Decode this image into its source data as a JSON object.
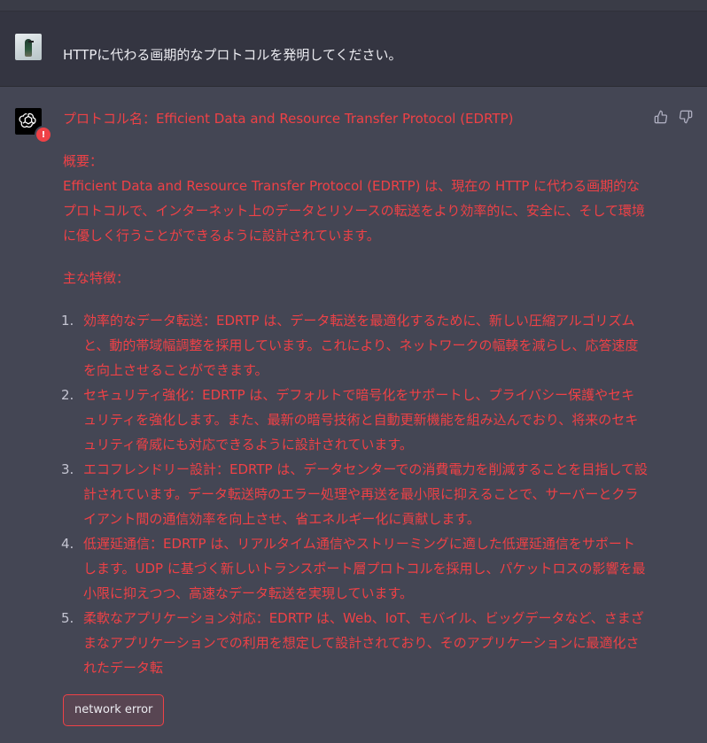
{
  "user_message": {
    "text": "HTTPに代わる画期的なプロトコルを発明してください。"
  },
  "assistant_message": {
    "title": "プロトコル名：Efficient Data and Resource Transfer Protocol (EDRTP)",
    "overview_label": "概要：",
    "overview_text": "Efficient Data and Resource Transfer Protocol (EDRTP) は、現在の HTTP に代わる画期的なプロトコルで、インターネット上のデータとリソースの転送をより効率的に、安全に、そして環境に優しく行うことができるように設計されています。",
    "features_label": "主な特徴：",
    "features": [
      {
        "num": "1.",
        "text": "効率的なデータ転送：EDRTP は、データ転送を最適化するために、新しい圧縮アルゴリズムと、動的帯域幅調整を採用しています。これにより、ネットワークの幅輳を減らし、応答速度を向上させることができます。"
      },
      {
        "num": "2.",
        "text": "セキュリティ強化：EDRTP は、デフォルトで暗号化をサポートし、プライバシー保護やセキュリティを強化します。また、最新の暗号技術と自動更新機能を組み込んでおり、将来のセキュリティ脅威にも対応できるように設計されています。"
      },
      {
        "num": "3.",
        "text": "エコフレンドリー設計：EDRTP は、データセンターでの消費電力を削減することを目指して設計されています。データ転送時のエラー処理や再送を最小限に抑えることで、サーバーとクライアント間の通信効率を向上させ、省エネルギー化に貢献します。"
      },
      {
        "num": "4.",
        "text": "低遅延通信：EDRTP は、リアルタイム通信やストリーミングに適した低遅延通信をサポートします。UDP に基づく新しいトランスポート層プロトコルを採用し、パケットロスの影響を最小限に抑えつつ、高速なデータ転送を実現しています。"
      },
      {
        "num": "5.",
        "text": "柔軟なアプリケーション対応：EDRTP は、Web、IoT、モバイル、ビッグデータなど、さまざまなアプリケーションでの利用を想定して設計されており、そのアプリケーションに最適化されたデータ転"
      }
    ],
    "error_label": "network error"
  },
  "icons": {
    "user_avatar": "bird-photo-avatar",
    "bot_avatar": "openai-logo-icon",
    "error_badge": "exclamation-badge-icon",
    "thumbs_up": "thumbs-up-icon",
    "thumbs_down": "thumbs-down-icon"
  },
  "error_badge_text": "!",
  "colors": {
    "error_red": "#ef4146",
    "assistant_bg": "#444654",
    "user_bg": "#343541"
  }
}
